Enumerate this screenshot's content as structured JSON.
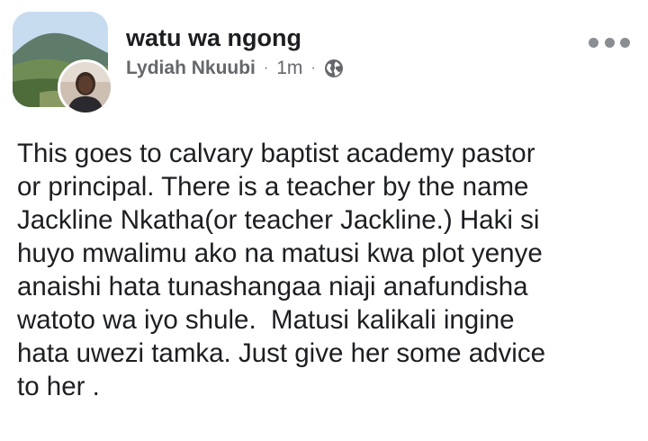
{
  "post": {
    "group_name": "watu wa ngong",
    "author": "Lydiah Nkuubi",
    "separator": "·",
    "time": "1m",
    "privacy_icon": "globe-icon",
    "more_icon": "more-horizontal-icon",
    "group_avatar_icon": "mountain-landscape-photo",
    "user_avatar_icon": "profile-photo",
    "body": "This goes to calvary baptist academy pastor\nor principal. There is a teacher by the name\nJackline Nkatha(or teacher Jackline.) Haki si\nhuyo mwalimu ako na matusi kwa plot yenye\nanaishi hata tunashangaa niaji anafundisha\nwatoto wa iyo shule.  Matusi kalikali ingine\nhata uwezi tamka. Just give her some advice\nto her ."
  },
  "colors": {
    "primary_text": "#1c1e21",
    "secondary_text": "#65676b",
    "icon_gray": "#8a8d91",
    "background": "#ffffff"
  }
}
